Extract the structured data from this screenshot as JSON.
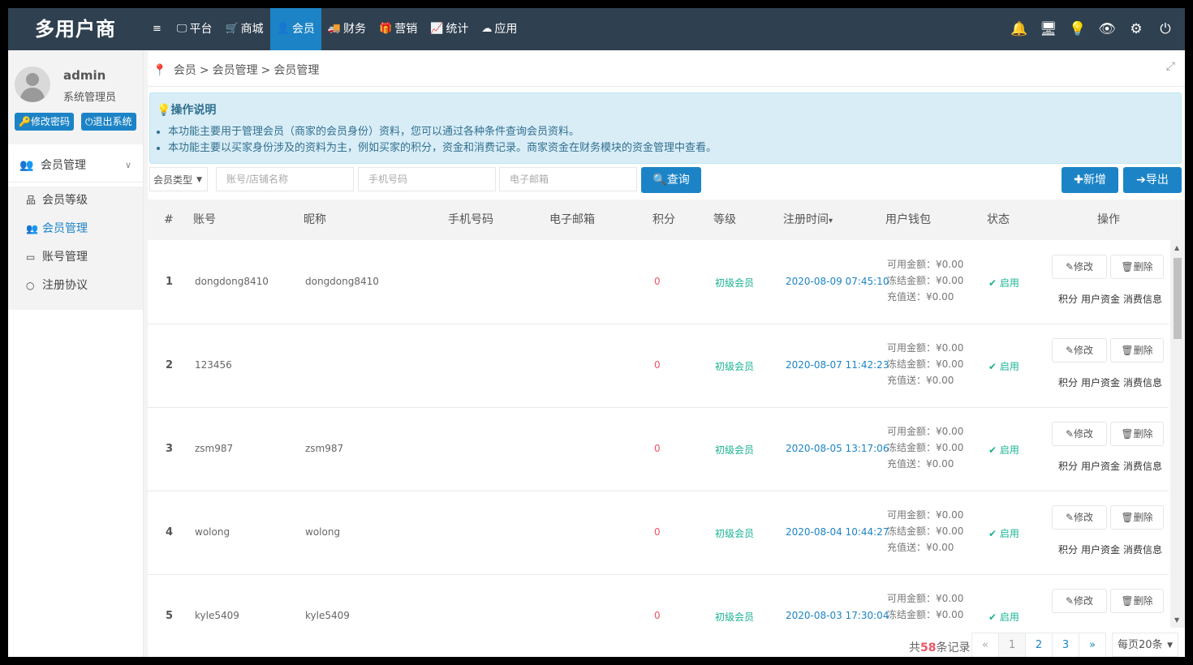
{
  "app_title": "多用户商",
  "topnav": [
    {
      "icon": "menu-icon",
      "glyph": "≡",
      "label": ""
    },
    {
      "icon": "desktop-icon",
      "glyph": "🖵",
      "label": "平台"
    },
    {
      "icon": "cart-icon",
      "glyph": "🛒",
      "label": "商城"
    },
    {
      "icon": "user-icon",
      "glyph": "👤",
      "label": "会员",
      "active": true
    },
    {
      "icon": "truck-icon",
      "glyph": "🚚",
      "label": "财务"
    },
    {
      "icon": "gift-icon",
      "glyph": "🎁",
      "label": "营销"
    },
    {
      "icon": "chart-icon",
      "glyph": "📈",
      "label": "统计"
    },
    {
      "icon": "cloud-icon",
      "glyph": "☁",
      "label": "应用"
    }
  ],
  "right_icons": [
    {
      "icon": "bell-icon",
      "glyph": "🔔"
    },
    {
      "icon": "monitor-icon",
      "glyph": "🖥"
    },
    {
      "icon": "bulb-icon",
      "glyph": "💡"
    },
    {
      "icon": "eye-icon",
      "glyph": "👁"
    },
    {
      "icon": "spinner-icon",
      "glyph": "⚙"
    },
    {
      "icon": "power-icon",
      "glyph": "⏻"
    }
  ],
  "user": {
    "name": "admin",
    "role": "系统管理员",
    "change_pwd": "修改密码",
    "logout": "退出系统"
  },
  "sidebar": {
    "section": "会员管理",
    "items": [
      {
        "icon": "sitemap-icon",
        "glyph": "品",
        "label": "会员等级",
        "active": false
      },
      {
        "icon": "users-icon",
        "glyph": "👥",
        "label": "会员管理",
        "active": true
      },
      {
        "icon": "id-card-icon",
        "glyph": "▭",
        "label": "账号管理",
        "active": false
      },
      {
        "icon": "circle-icon",
        "glyph": "○",
        "label": "注册协议",
        "active": false
      }
    ]
  },
  "breadcrumb": [
    "会员",
    ">",
    "会员管理",
    ">",
    "会员管理"
  ],
  "info": {
    "title": "操作说明",
    "lines": [
      "本功能主要用于管理会员（商家的会员身份）资料，您可以通过各种条件查询会员资料。",
      "本功能主要以买家身份涉及的资料为主，例如买家的积分，资金和消费记录。商家资金在财务模块的资金管理中查看。"
    ]
  },
  "filters": {
    "type_select": "会员类型",
    "account_placeholder": "账号/店铺名称",
    "phone_placeholder": "手机号码",
    "email_placeholder": "电子邮箱",
    "search_label": "查询",
    "add_label": "新增",
    "export_label": "导出"
  },
  "table": {
    "headers": [
      "#",
      "账号",
      "昵称",
      "手机号码",
      "电子邮箱",
      "积分",
      "等级",
      "注册时间",
      "用户钱包",
      "状态",
      "操作"
    ],
    "sort_marker": "▾",
    "rows": [
      {
        "no": "1",
        "account": "dongdong8410",
        "nick": "dongdong8410",
        "phone": "",
        "email": "",
        "points": "0",
        "level": "初级会员",
        "time": "2020-08-09 07:45:10",
        "avail": "可用金额：¥0.00",
        "frozen": "冻结金额：¥0.00",
        "bonus": "充值送：¥0.00",
        "status": "启用"
      },
      {
        "no": "2",
        "account": "123456",
        "nick": "",
        "phone": "",
        "email": "",
        "points": "0",
        "level": "初级会员",
        "time": "2020-08-07 11:42:23",
        "avail": "可用金额：¥0.00",
        "frozen": "冻结金额：¥0.00",
        "bonus": "充值送：¥0.00",
        "status": "启用"
      },
      {
        "no": "3",
        "account": "zsm987",
        "nick": "zsm987",
        "phone": "",
        "email": "",
        "points": "0",
        "level": "初级会员",
        "time": "2020-08-05 13:17:06",
        "avail": "可用金额：¥0.00",
        "frozen": "冻结金额：¥0.00",
        "bonus": "充值送：¥0.00",
        "status": "启用"
      },
      {
        "no": "4",
        "account": "wolong",
        "nick": "wolong",
        "phone": "",
        "email": "",
        "points": "0",
        "level": "初级会员",
        "time": "2020-08-04 10:44:27",
        "avail": "可用金额：¥0.00",
        "frozen": "冻结金额：¥0.00",
        "bonus": "充值送：¥0.00",
        "status": "启用"
      },
      {
        "no": "5",
        "account": "kyle5409",
        "nick": "kyle5409",
        "phone": "",
        "email": "",
        "points": "0",
        "level": "初级会员",
        "time": "2020-08-03 17:30:04",
        "avail": "可用金额：¥0.00",
        "frozen": "冻结金额：¥0.00",
        "bonus": "",
        "status": "启用"
      }
    ],
    "edit_label": "修改",
    "delete_label": "删除",
    "link_points": "积分",
    "link_funds": "用户资金",
    "link_consume": "消费信息"
  },
  "footer": {
    "total_prefix": "共",
    "total_count": "58",
    "total_suffix": "条记录",
    "pages": [
      "«",
      "1",
      "2",
      "3",
      "»"
    ],
    "per_page": "每页20条"
  },
  "colors": {
    "topbar": "#2f4050",
    "accent": "#1c84c6",
    "green": "#1ab394",
    "red": "#ed5565"
  }
}
